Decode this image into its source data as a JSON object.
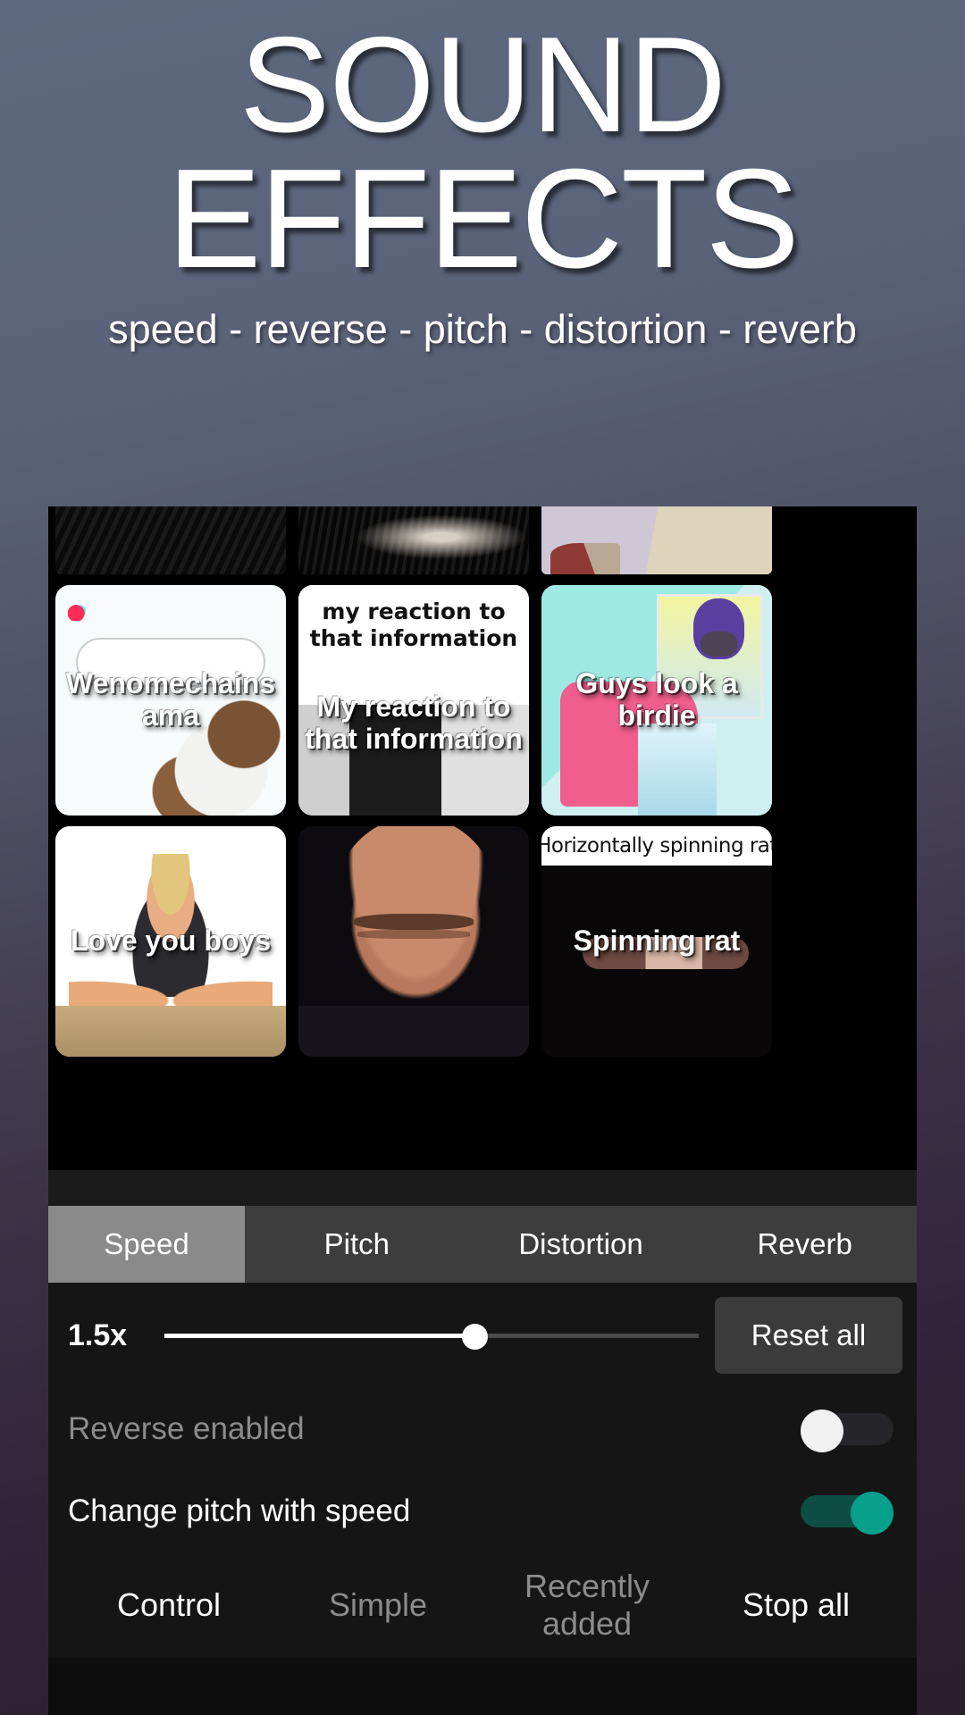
{
  "hero": {
    "title_line1": "SOUND",
    "title_line2": "EFFECTS",
    "subtitle": "speed - reverse - pitch - distortion - reverb"
  },
  "grid": {
    "partial_row": [
      {
        "name": "thumb-dark-keyboard"
      },
      {
        "name": "thumb-dark-figure"
      },
      {
        "name": "thumb-cloth"
      }
    ],
    "cards": [
      {
        "label": "Wenomechains ama",
        "art": "tiktok"
      },
      {
        "label": "My reaction to that information",
        "art": "reaction",
        "caption": "my reaction to that information"
      },
      {
        "label": "Guys look a birdie",
        "art": "birdie"
      },
      {
        "label": "Love you boys",
        "art": "boys"
      },
      {
        "label": "",
        "art": "face"
      },
      {
        "label": "Spinning rat",
        "art": "rat",
        "caption": "Horizontally spinning rat"
      }
    ]
  },
  "controls": {
    "tabs": [
      {
        "label": "Speed",
        "active": true
      },
      {
        "label": "Pitch",
        "active": false
      },
      {
        "label": "Distortion",
        "active": false
      },
      {
        "label": "Reverb",
        "active": false
      }
    ],
    "speed_value": "1.5x",
    "slider_percent": 58,
    "reset_label": "Reset all",
    "toggles": [
      {
        "label": "Reverse enabled",
        "state": "off"
      },
      {
        "label": "Change pitch with speed",
        "state": "on"
      }
    ]
  },
  "bottom_nav": [
    {
      "label": "Control",
      "active": true
    },
    {
      "label": "Simple",
      "active": false
    },
    {
      "label": "Recently added",
      "active": false
    },
    {
      "label": "Stop all",
      "active": true
    }
  ],
  "colors": {
    "accent_teal": "#07a08a",
    "active_tab": "#8a8a8a",
    "panel_bg": "#151515"
  }
}
